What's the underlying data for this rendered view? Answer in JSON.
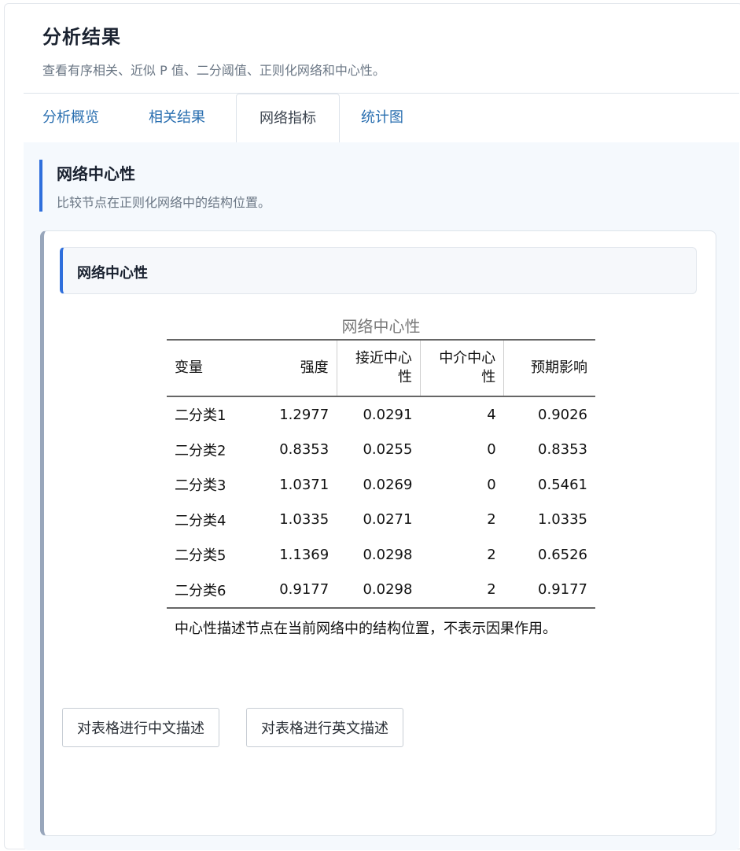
{
  "header": {
    "title": "分析结果",
    "subtitle": "查看有序相关、近似 P 值、二分阈值、正则化网络和中心性。"
  },
  "tabs": [
    {
      "label": "分析概览",
      "active": false
    },
    {
      "label": "相关结果",
      "active": false
    },
    {
      "label": "网络指标",
      "active": true
    },
    {
      "label": "统计图",
      "active": false
    }
  ],
  "section": {
    "title": "网络中心性",
    "description": "比较节点在正则化网络中的结构位置。"
  },
  "card": {
    "title": "网络中心性",
    "table": {
      "caption": "网络中心性",
      "columns": [
        "变量",
        "强度",
        "接近中心性",
        "中介中心性",
        "预期影响"
      ],
      "rows": [
        [
          "二分类1",
          "1.2977",
          "0.0291",
          "4",
          "0.9026"
        ],
        [
          "二分类2",
          "0.8353",
          "0.0255",
          "0",
          "0.8353"
        ],
        [
          "二分类3",
          "1.0371",
          "0.0269",
          "0",
          "0.5461"
        ],
        [
          "二分类4",
          "1.0335",
          "0.0271",
          "2",
          "1.0335"
        ],
        [
          "二分类5",
          "1.1369",
          "0.0298",
          "2",
          "0.6526"
        ],
        [
          "二分类6",
          "0.9177",
          "0.0298",
          "2",
          "0.9177"
        ]
      ],
      "note": "中心性描述节点在当前网络中的结构位置，不表示因果作用。"
    },
    "buttons": {
      "describe_zh": "对表格进行中文描述",
      "describe_en": "对表格进行英文描述"
    }
  },
  "colors": {
    "accent": "#2f6fdc",
    "tab_link": "#2a6fb0",
    "card_border_left": "#98a6bb",
    "panel_bg": "#f5f9fd"
  }
}
